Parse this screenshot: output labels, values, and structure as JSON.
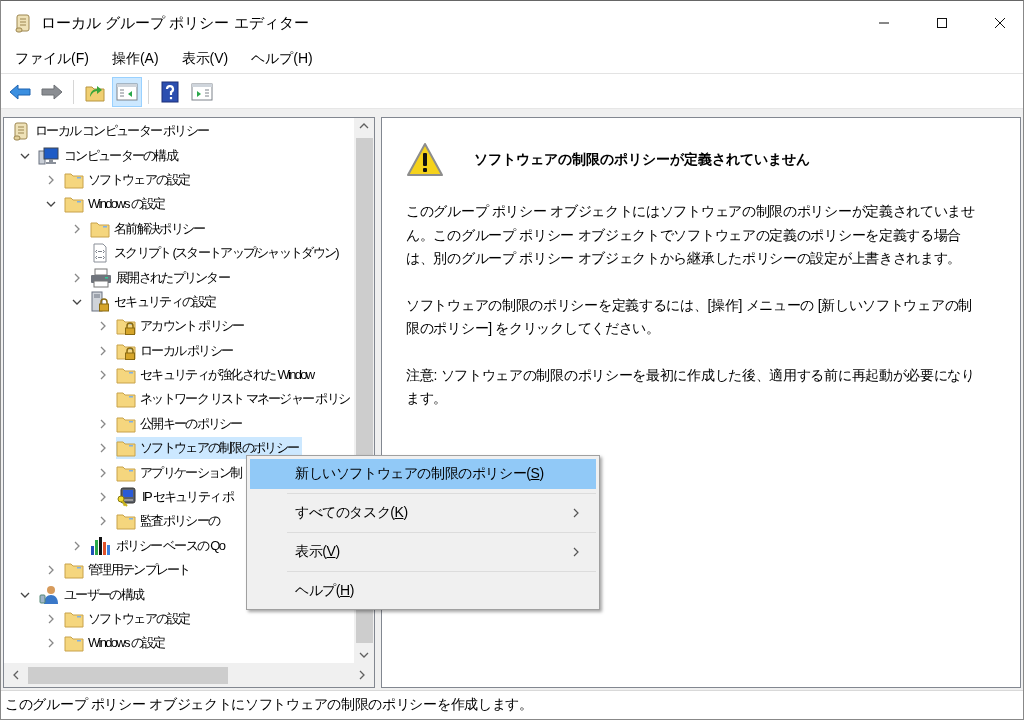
{
  "window": {
    "title": "ローカル グループ ポリシー エディター"
  },
  "menu_bar": [
    "ファイル(F)",
    "操作(A)",
    "表示(V)",
    "ヘルプ(H)"
  ],
  "toolbar": [
    {
      "kind": "back",
      "disabled": false,
      "pressed": false
    },
    {
      "kind": "forward",
      "disabled": true,
      "pressed": false
    },
    {
      "kind": "separator"
    },
    {
      "kind": "up",
      "disabled": false,
      "pressed": false
    },
    {
      "kind": "show-tree",
      "disabled": false,
      "pressed": true
    },
    {
      "kind": "separator"
    },
    {
      "kind": "help",
      "disabled": false,
      "pressed": false
    },
    {
      "kind": "show-action-pane",
      "disabled": false,
      "pressed": false
    }
  ],
  "tree": {
    "items": [
      {
        "label": "ローカル コンピューター ポリシー",
        "kind": "scroll",
        "selected": false,
        "children": [
          {
            "label": "コンピューターの構成",
            "kind": "computer",
            "selected": false,
            "expanded": true,
            "children": [
              {
                "label": "ソフトウェアの設定",
                "kind": "folder",
                "selected": false,
                "expanded": false
              },
              {
                "label": "Windows の設定",
                "kind": "folder",
                "selected": false,
                "expanded": true,
                "children": [
                  {
                    "label": "名前解決ポリシー",
                    "kind": "folder",
                    "selected": false,
                    "expanded": false
                  },
                  {
                    "label": "スクリプト (スタートアップ/シャットダウン)",
                    "kind": "script",
                    "selected": false
                  },
                  {
                    "label": "展開されたプリンター",
                    "kind": "printer",
                    "selected": false,
                    "expanded": false
                  },
                  {
                    "label": "セキュリティの設定",
                    "kind": "security",
                    "selected": false,
                    "expanded": true,
                    "children": [
                      {
                        "label": "アカウント ポリシー",
                        "kind": "folder-lock",
                        "selected": false,
                        "expanded": false
                      },
                      {
                        "label": "ローカル ポリシー",
                        "kind": "folder-lock",
                        "selected": false,
                        "expanded": false
                      },
                      {
                        "label": "セキュリティが強化された Window",
                        "kind": "folder",
                        "selected": false,
                        "expanded": false
                      },
                      {
                        "label": "ネットワーク リスト マネージャー ポリシ",
                        "kind": "folder",
                        "selected": false
                      },
                      {
                        "label": "公開キーのポリシー",
                        "kind": "folder",
                        "selected": false,
                        "expanded": false
                      },
                      {
                        "label": "ソフトウェアの制限のポリシー",
                        "kind": "folder",
                        "selected": true,
                        "expanded": false
                      },
                      {
                        "label": "アプリケーション制",
                        "kind": "folder",
                        "selected": false,
                        "expanded": false
                      },
                      {
                        "label": "IP セキュリティ ポ",
                        "kind": "ip-security",
                        "selected": false,
                        "expanded": false
                      },
                      {
                        "label": "監査ポリシーの",
                        "kind": "folder",
                        "selected": false,
                        "expanded": false
                      }
                    ]
                  },
                  {
                    "label": "ポリシー ベースの Qo",
                    "kind": "chart",
                    "selected": false,
                    "expanded": false
                  }
                ]
              },
              {
                "label": "管理用テンプレート",
                "kind": "folder",
                "selected": false,
                "expanded": false
              }
            ]
          },
          {
            "label": "ユーザーの構成",
            "kind": "user",
            "selected": false,
            "expanded": true,
            "children": [
              {
                "label": "ソフトウェアの設定",
                "kind": "folder",
                "selected": false,
                "expanded": false
              },
              {
                "label": "Windows の設定",
                "kind": "folder",
                "selected": false,
                "expanded": false
              }
            ]
          }
        ]
      }
    ]
  },
  "detail": {
    "heading": "ソフトウェアの制限のポリシーが定義されていません",
    "paragraphs": [
      "このグループ ポリシー オブジェクトにはソフトウェアの制限のポリシーが定義されていません。このグループ ポリシー オブジェクトでソフトウェアの定義のポリシーを定義する場合は、別のグループ ポリシー オブジェクトから継承したポリシーの設定が上書きされます。",
      "ソフトウェアの制限のポリシーを定義するには、[操作] メニューの [新しいソフトウェアの制限のポリシー] をクリックしてください。",
      "注意: ソフトウェアの制限のポリシーを最初に作成した後、適用する前に再起動が必要になります。"
    ]
  },
  "context_menu": {
    "items": [
      {
        "label": "新しいソフトウェアの制限のポリシー(S)",
        "selected": true,
        "submenu": false
      },
      {
        "label": "すべてのタスク(K)",
        "selected": false,
        "submenu": true
      },
      {
        "label": "表示(V)",
        "selected": false,
        "submenu": true
      },
      {
        "label": "ヘルプ(H)",
        "selected": false,
        "submenu": false
      }
    ]
  },
  "status_bar": {
    "text": "このグループ ポリシー オブジェクトにソフトウェアの制限のポリシーを作成します。"
  }
}
